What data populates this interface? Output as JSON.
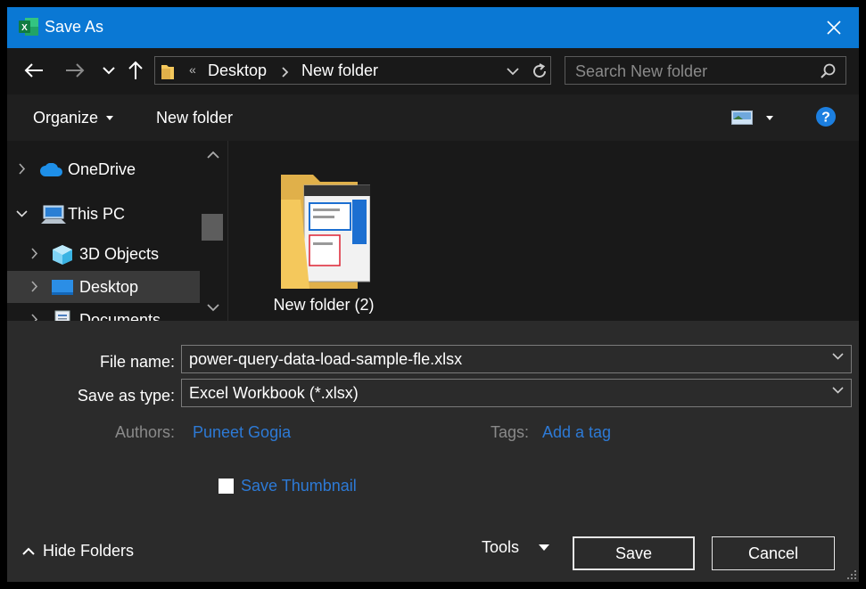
{
  "window": {
    "title": "Save As"
  },
  "navigation": {
    "address": {
      "overflow": "«",
      "crumbs": [
        "Desktop",
        "New folder"
      ]
    },
    "search_placeholder": "Search New folder"
  },
  "toolbar": {
    "organize": "Organize",
    "new_folder": "New folder"
  },
  "tree": [
    {
      "label": "OneDrive",
      "expanded": false,
      "icon": "onedrive-cloud-icon"
    },
    {
      "label": "This PC",
      "expanded": true,
      "icon": "computer-icon"
    },
    {
      "label": "3D Objects",
      "expanded": false,
      "icon": "3d-objects-icon"
    },
    {
      "label": "Desktop",
      "expanded": false,
      "icon": "desktop-icon",
      "selected": true
    },
    {
      "label": "Documents",
      "expanded": false,
      "icon": "documents-icon"
    }
  ],
  "content": {
    "items": [
      {
        "name": "New folder (2)",
        "icon": "folder-with-preview-icon"
      }
    ]
  },
  "form": {
    "file_name_label": "File name:",
    "file_name_value": "power-query-data-load-sample-fle.xlsx",
    "save_type_label": "Save as type:",
    "save_type_value": "Excel Workbook (*.xlsx)",
    "authors_label": "Authors:",
    "authors_value": "Puneet Gogia",
    "tags_label": "Tags:",
    "tags_value": "Add a tag",
    "save_thumbnail_label": "Save Thumbnail",
    "save_thumbnail_checked": false
  },
  "footer": {
    "hide_folders": "Hide Folders",
    "tools": "Tools",
    "save": "Save",
    "cancel": "Cancel"
  },
  "colors": {
    "titlebar": "#0a78d4",
    "link": "#2d7ad6",
    "help": "#1c7fe0",
    "folder": "#f4c85c"
  }
}
